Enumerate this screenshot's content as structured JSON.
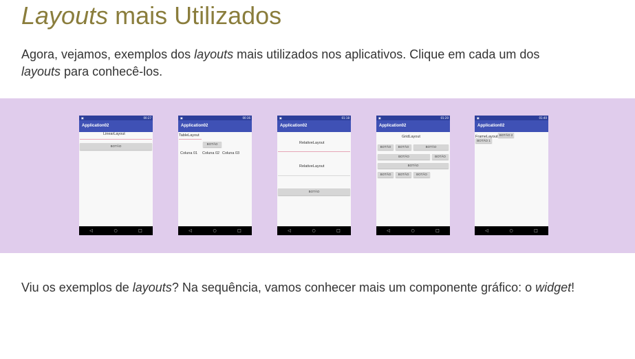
{
  "title": {
    "italic": "Layouts",
    "rest": " mais Utilizados"
  },
  "intro": {
    "p1": "Agora, vejamos, exemplos dos ",
    "i1": "layouts",
    "p2": " mais utilizados nos aplicativos. Clique em cada um dos ",
    "i2": "layouts",
    "p3": " para conhecê-los."
  },
  "colors": {
    "title": "#8a7d3c",
    "band": "#e0ccec",
    "appbar": "#3f51b5",
    "statusbar": "#2d3f9a"
  },
  "phones": [
    {
      "app": "Application02",
      "time": "00:27",
      "linear_label": "LinearLayout",
      "button": "BOTÃO"
    },
    {
      "app": "Application02",
      "time": "00:36",
      "table_label": "TableLayout",
      "button": "BOTÃO",
      "col1": "Coluna 01",
      "col2": "Coluna 02",
      "col3": "Coluna 03"
    },
    {
      "app": "Application02",
      "time": "01:18",
      "rel1": "RelativeLayout",
      "rel2": "RelativeLayout",
      "button": "BOTÃO"
    },
    {
      "app": "Application02",
      "time": "01:20",
      "grid_label": "GridLayout",
      "button": "BOTÃO"
    },
    {
      "app": "Application02",
      "time": "01:40",
      "frame_label": "FrameLayout",
      "btn1": "BOTÃO 1",
      "btn2": "BOTÃO 2"
    }
  ],
  "nav_icons": {
    "back": "◁",
    "home": "○",
    "recent": "□"
  },
  "outro": {
    "p1": "Viu os exemplos de ",
    "i1": "layouts",
    "p2": "? Na sequência, vamos conhecer mais um componente gráfico: o ",
    "i2": "widget",
    "p3": "!"
  }
}
